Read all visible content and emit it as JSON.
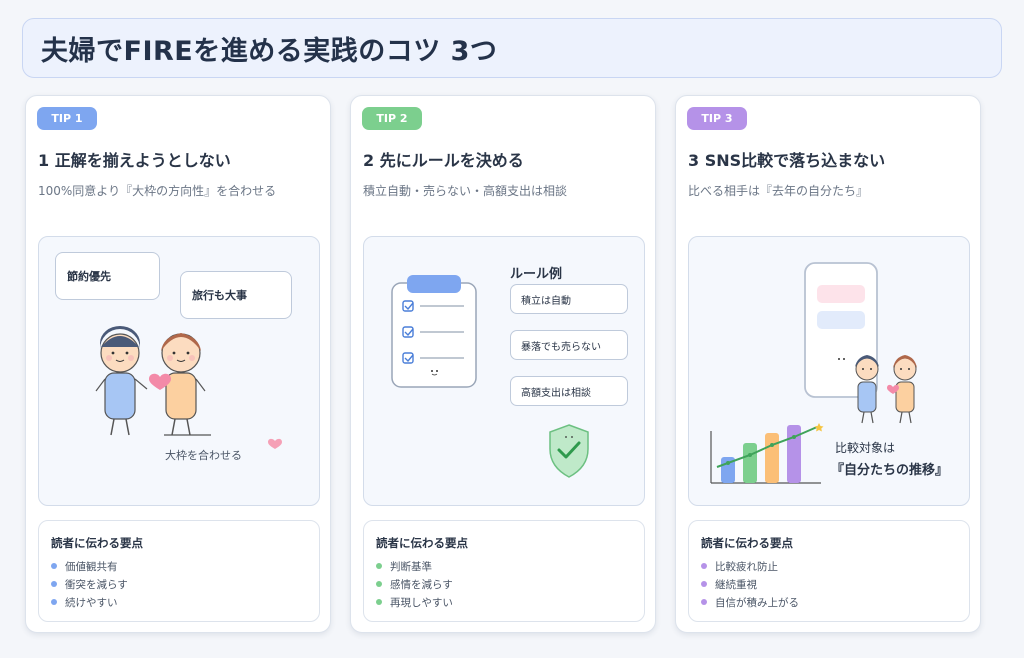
{
  "page": {
    "title": "夫婦でFIREを進める実践のコツ 3つ"
  },
  "tips": [
    {
      "badge": "TIP 1",
      "color": "#7ea6f0",
      "title": "1 正解を揃えようとしない",
      "subtitle": "100%同意より『大枠の方向性』を合わせる",
      "illustration": {
        "bubble_left": "節約優先",
        "bubble_right": "旅行も大事",
        "caption": "大枠を合わせる"
      },
      "points_title": "読者に伝わる要点",
      "points": [
        "価値観共有",
        "衝突を減らす",
        "続けやすい"
      ]
    },
    {
      "badge": "TIP 2",
      "color": "#7ccf8e",
      "title": "2 先にルールを決める",
      "subtitle": "積立自動・売らない・高額支出は相談",
      "illustration": {
        "rules_title": "ルール例",
        "rules": [
          "積立は自動",
          "暴落でも売らない",
          "高額支出は相談"
        ]
      },
      "points_title": "読者に伝わる要点",
      "points": [
        "判断基準",
        "感情を減らす",
        "再現しやすい"
      ]
    },
    {
      "badge": "TIP 3",
      "color": "#b592e8",
      "title": "3 SNS比較で落ち込まない",
      "subtitle": "比べる相手は『去年の自分たち』",
      "illustration": {
        "compare_label": "比較対象は",
        "compare_target": "『自分たちの推移』"
      },
      "points_title": "読者に伝わる要点",
      "points": [
        "比較疲れ防止",
        "継続重視",
        "自信が積み上がる"
      ]
    }
  ]
}
